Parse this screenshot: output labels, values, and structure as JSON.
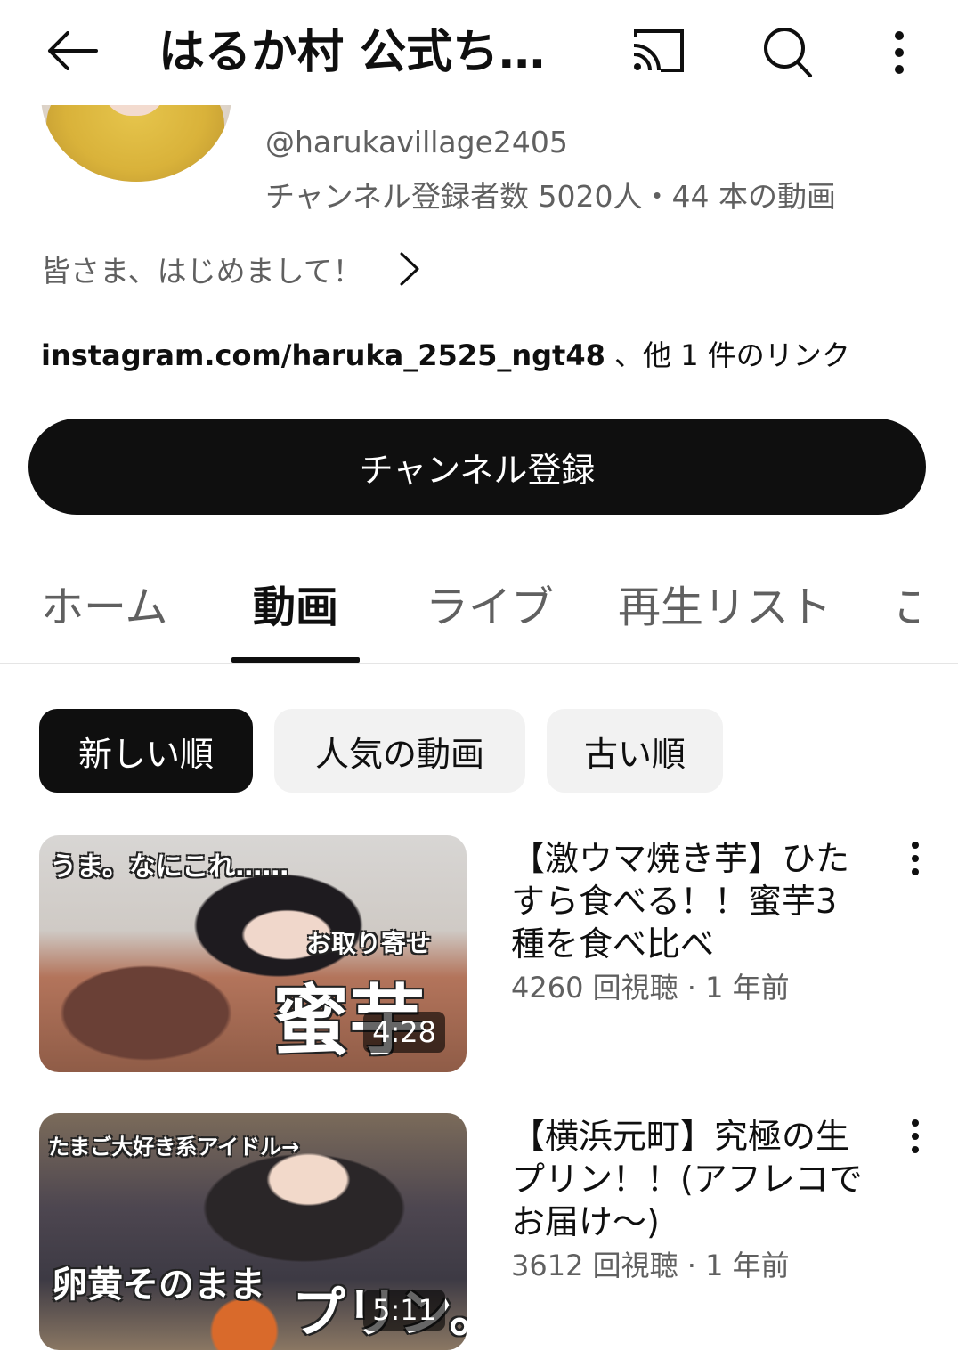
{
  "topbar": {
    "title": "はるか村 公式ち…",
    "icons": {
      "back": "back-arrow-icon",
      "cast": "cast-icon",
      "search": "search-icon",
      "more": "more-vert-icon"
    }
  },
  "channel": {
    "handle": "@harukavillage2405",
    "stats": "チャンネル登録者数 5020人・44 本の動画",
    "description": "皆さま、はじめまして！",
    "link_main": "instagram.com/haruka_2525_ngt48",
    "link_others": " 、他 1 件のリンク",
    "subscribe_label": "チャンネル登録"
  },
  "tabs": [
    {
      "label": "ホーム",
      "active": false
    },
    {
      "label": "動画",
      "active": true
    },
    {
      "label": "ライブ",
      "active": false
    },
    {
      "label": "再生リスト",
      "active": false
    },
    {
      "label": "こ",
      "active": false
    }
  ],
  "chips": [
    {
      "label": "新しい順",
      "selected": true
    },
    {
      "label": "人気の動画",
      "selected": false
    },
    {
      "label": "古い順",
      "selected": false
    }
  ],
  "videos": [
    {
      "title": "【激ウマ焼き芋】ひたすら食べる！！蜜芋3種を食べ比べ",
      "meta": "4260 回視聴 · 1 年前",
      "duration": "4:28",
      "thumb_captions": [
        "うま。なにこれ……",
        "お取り寄せ",
        "蜜芋"
      ]
    },
    {
      "title": "【横浜元町】究極の生プリン！！(アフレコでお届け〜)",
      "meta": "3612 回視聴 · 1 年前",
      "duration": "5:11",
      "thumb_captions": [
        "たまご大好き系アイドル→",
        "卵黄そのまま",
        "プリン。"
      ]
    }
  ],
  "colors": {
    "text_primary": "#0f0f0f",
    "text_secondary": "#606060",
    "chip_bg": "#f2f2f2",
    "button_bg": "#0f0f0f"
  }
}
